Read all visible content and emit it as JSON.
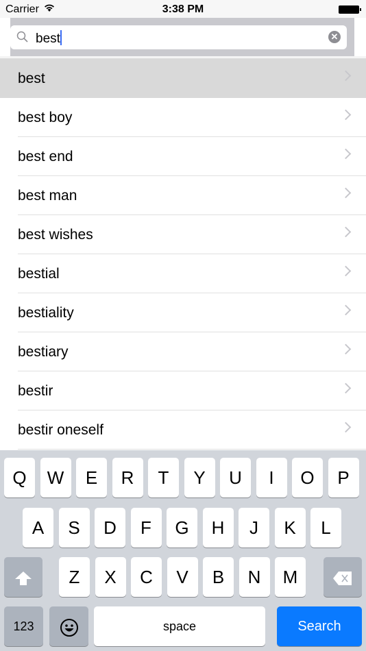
{
  "status": {
    "carrier": "Carrier",
    "time": "3:38 PM"
  },
  "search": {
    "value": "best",
    "icon": "magnifier-icon",
    "clear_icon": "clear-x-icon"
  },
  "results": [
    {
      "label": "best",
      "selected": true
    },
    {
      "label": "best boy"
    },
    {
      "label": "best end"
    },
    {
      "label": "best man"
    },
    {
      "label": "best wishes"
    },
    {
      "label": "bestial"
    },
    {
      "label": "bestiality"
    },
    {
      "label": "bestiary"
    },
    {
      "label": "bestir"
    },
    {
      "label": "bestir oneself"
    }
  ],
  "keyboard": {
    "row1": [
      "Q",
      "W",
      "E",
      "R",
      "T",
      "Y",
      "U",
      "I",
      "O",
      "P"
    ],
    "row2": [
      "A",
      "S",
      "D",
      "F",
      "G",
      "H",
      "J",
      "K",
      "L"
    ],
    "row3": [
      "Z",
      "X",
      "C",
      "V",
      "B",
      "N",
      "M"
    ],
    "numbers": "123",
    "space": "space",
    "search": "Search",
    "accent": "#0a7aff"
  }
}
